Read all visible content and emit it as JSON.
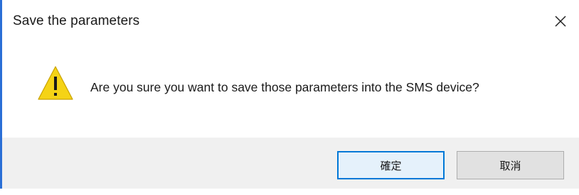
{
  "dialog": {
    "title": "Save the parameters",
    "message": "Are you sure you want to save those parameters into the SMS device?",
    "icon": "warning-icon",
    "close_icon": "close-icon"
  },
  "buttons": {
    "ok_label": "確定",
    "cancel_label": "取消"
  },
  "colors": {
    "warning_fill": "#f5d316",
    "accent": "#0078d7",
    "footer_bg": "#f0f0f0"
  }
}
